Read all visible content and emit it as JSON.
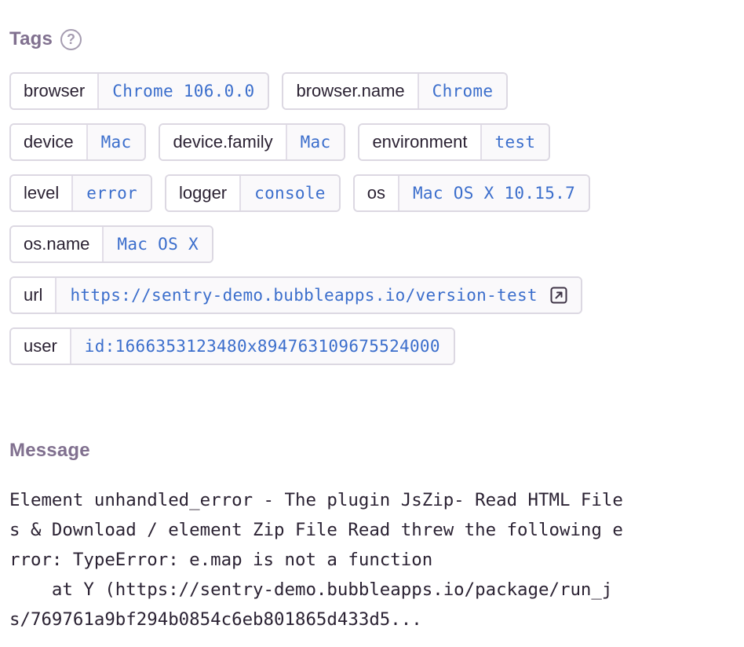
{
  "tags_section": {
    "title": "Tags",
    "help_glyph": "?",
    "rows": [
      [
        {
          "key": "browser",
          "value": "Chrome 106.0.0"
        },
        {
          "key": "browser.name",
          "value": "Chrome"
        }
      ],
      [
        {
          "key": "device",
          "value": "Mac"
        },
        {
          "key": "device.family",
          "value": "Mac"
        },
        {
          "key": "environment",
          "value": "test"
        }
      ],
      [
        {
          "key": "level",
          "value": "error"
        },
        {
          "key": "logger",
          "value": "console"
        },
        {
          "key": "os",
          "value": "Mac OS X 10.15.7"
        }
      ],
      [
        {
          "key": "os.name",
          "value": "Mac OS X"
        }
      ],
      [
        {
          "key": "url",
          "value": "https://sentry-demo.bubbleapps.io/version-test",
          "icon": "external-link-icon"
        }
      ],
      [
        {
          "key": "user",
          "value": "id:1666353123480x894763109675524000"
        }
      ]
    ]
  },
  "message_section": {
    "title": "Message",
    "lines": [
      "Element unhandled_error - The plugin JsZip- Read HTML File",
      "s & Download / element Zip File Read threw the following e",
      "rror: TypeError: e.map is not a function",
      "    at Y (https://sentry-demo.bubbleapps.io/package/run_j",
      "s/769761a9bf294b0854c6eb801865d433d5..."
    ]
  },
  "colors": {
    "section_title": "#80708f",
    "tag_value": "#3b6ecc",
    "tag_border": "#dcd8e2",
    "text": "#2b2233"
  }
}
